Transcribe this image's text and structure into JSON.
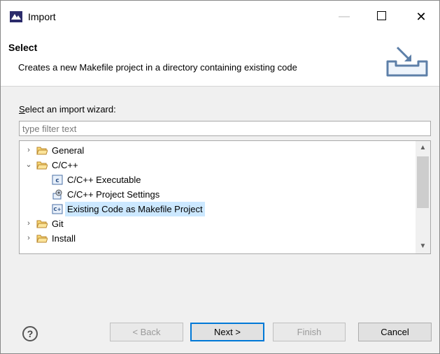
{
  "window": {
    "title": "Import"
  },
  "titlebar": {
    "minimize": "—",
    "close": "✕"
  },
  "banner": {
    "title": "Select",
    "description": "Creates a new Makefile project in a directory containing existing code"
  },
  "wizard": {
    "label_prefix": "S",
    "label_rest": "elect an import wizard:",
    "filter_placeholder": "type filter text"
  },
  "tree": {
    "items": [
      {
        "label": "General",
        "icon": "folder-icon",
        "expander": "›",
        "selected": false
      },
      {
        "label": "C/C++",
        "icon": "folder-icon",
        "expander": "⌄",
        "selected": false
      },
      {
        "label": "C/C++ Executable",
        "icon": "c-executable-icon",
        "expander": "",
        "selected": false
      },
      {
        "label": "C/C++ Project Settings",
        "icon": "project-settings-icon",
        "expander": "",
        "selected": false
      },
      {
        "label": "Existing Code as Makefile Project",
        "icon": "makefile-project-icon",
        "expander": "",
        "selected": true
      },
      {
        "label": "Git",
        "icon": "folder-icon",
        "expander": "›",
        "selected": false
      },
      {
        "label": "Install",
        "icon": "folder-icon",
        "expander": "›",
        "selected": false
      }
    ]
  },
  "scrollbar": {
    "up": "▲",
    "down": "▼"
  },
  "buttons": {
    "help": "?",
    "back": "< Back",
    "next": "Next >",
    "finish": "Finish",
    "cancel": "Cancel"
  },
  "colors": {
    "selection": "#cce8ff",
    "default_button_border": "#0078d7",
    "folder": "#e8b64a"
  }
}
